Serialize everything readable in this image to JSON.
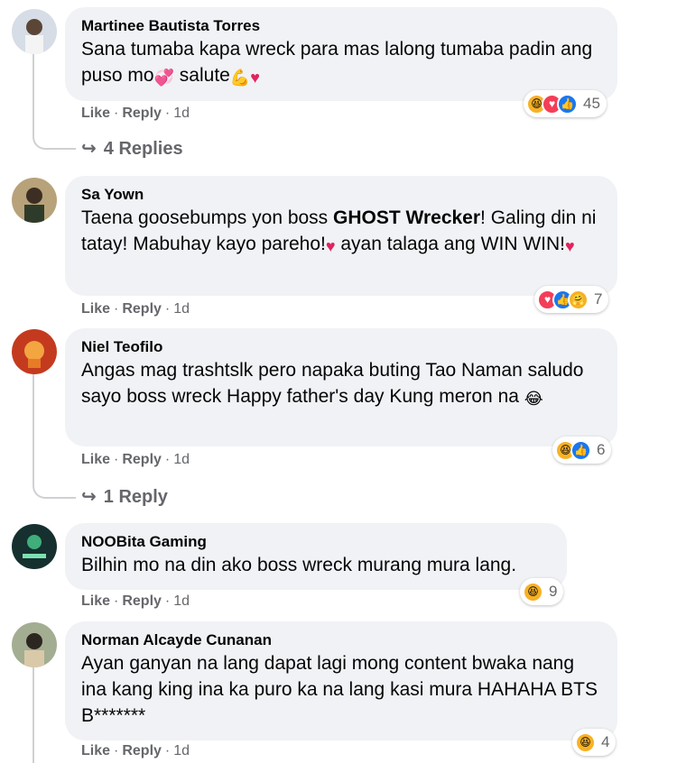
{
  "comments": [
    {
      "author": "Martinee Bautista Torres",
      "text_parts": [
        "Sana tumaba kapa wreck para mas lalong tumaba padin ang puso mo",
        " salute",
        ""
      ],
      "actions": {
        "like": "Like",
        "reply": "Reply",
        "time": "1d"
      },
      "reaction_count": "45",
      "replies_label": "4 Replies",
      "avatar_color": "#8a9bb0"
    },
    {
      "author": "Sa Yown",
      "text_before": "Taena goosebumps yon boss ",
      "text_bold": "GHOST Wrecker",
      "text_after": "! Galing din ni tatay! Mabuhay kayo pareho!",
      "text_tail": " ayan talaga ang WIN WIN!",
      "actions": {
        "like": "Like",
        "reply": "Reply",
        "time": "1d"
      },
      "reaction_count": "7",
      "avatar_color": "#5a6b4e"
    },
    {
      "author": "Niel Teofilo",
      "text": "Angas mag trashtslk pero napaka buting Tao Naman saludo sayo boss wreck Happy father's day Kung meron na",
      "actions": {
        "like": "Like",
        "reply": "Reply",
        "time": "1d"
      },
      "reaction_count": "6",
      "replies_label": "1 Reply",
      "avatar_color": "#c0341d"
    },
    {
      "author": "NOOBita Gaming",
      "text": "Bilhin mo na din ako boss wreck murang mura lang.",
      "actions": {
        "like": "Like",
        "reply": "Reply",
        "time": "1d"
      },
      "reaction_count": "9",
      "avatar_color": "#1d3a3a"
    },
    {
      "author": "Norman Alcayde Cunanan",
      "text": "Ayan ganyan na lang dapat lagi mong content bwaka nang ina kang king ina ka puro ka na lang kasi mura HAHAHA BTS B*******",
      "actions": {
        "like": "Like",
        "reply": "Reply",
        "time": "1d"
      },
      "reaction_count": "4",
      "avatar_color": "#9aa58a"
    }
  ],
  "icons": {
    "haha": "haha-reaction-icon",
    "love": "love-reaction-icon",
    "like": "like-reaction-icon",
    "care": "care-reaction-icon",
    "reply_arrow": "reply-arrow-icon"
  },
  "colors": {
    "like_blue": "#1877f2",
    "love_red": "#f33e58",
    "haha_yellow": "#f7b125",
    "bubble_bg": "#f0f2f5",
    "meta_gray": "#65676b"
  }
}
